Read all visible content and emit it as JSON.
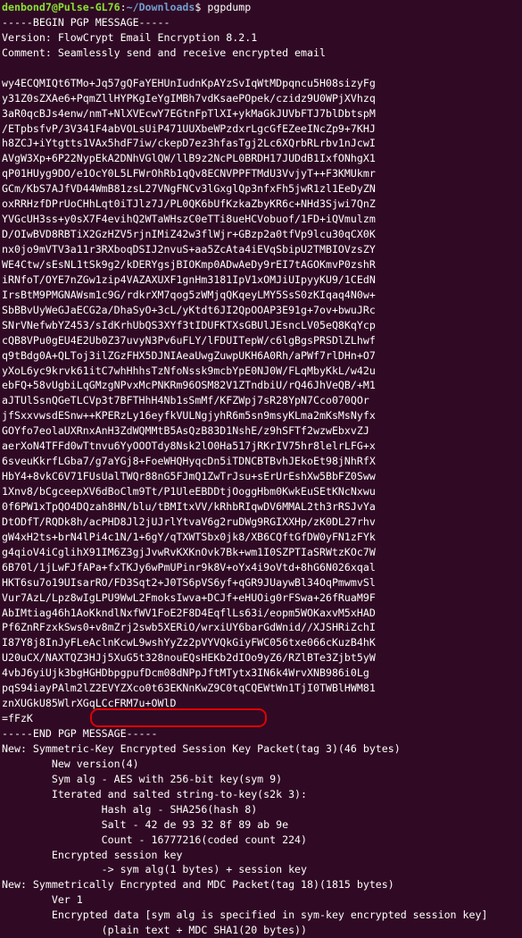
{
  "prompt": {
    "user_host": "denbond7@Pulse-GL76",
    "separator": ":",
    "path": "~/Downloads",
    "symbol": "$ ",
    "command": "pgpdump"
  },
  "lines": [
    "-----BEGIN PGP MESSAGE-----",
    "Version: FlowCrypt Email Encryption 8.2.1",
    "Comment: Seamlessly send and receive encrypted email",
    "",
    "wy4ECQMIQt6TMo+Jq57gQFaYEHUnIudnKpAYzSvIqWtMDpqncu5H08sizyFg",
    "y31Z0sZXAe6+PqmZllHYPKgIeYgIMBh7vdKsaePOpek/czidz9U0WPjXVhzq",
    "3aR0qcBJs4enw/nmT+NlXVEcwY7EGtnFpTlXI+ykMaGkJUVbFTJ7blDbtspM",
    "/ETpbsfvP/3V341F4abVOLsUiP471UUXbeWPzdxrLgcGfEZeeINcZp9+7KHJ",
    "h8ZCJ+iYtgtts1VAx5hdF7iw/ckepD7ez3hfasTgj2Lc6XQrbRLrbv1nJcwI",
    "AVgW3Xp+6P22NypEkA2DNhVGlQW/llB9z2NcPL0BRDH17JUDdB1IxfONhgX1",
    "qP01HUyg9DO/e1OcY0L5LFWrOhRb1qQv8ECNVPPFTMdU3VvjyT++F3KMUkmr",
    "GCm/KbS7AJfVD44WmB81zsL27VNgFNCv3lGxglQp3nfxFh5jwR1zl1EeDyZN",
    "oxRRHzfDPrUoCHhLqt0iTJlz7J/PL0QK6bUfKzkaZbyKR6c+NHd3Sjwi7QnZ",
    "YVGcUH3ss+y0sX7F4evihQ2WTaWHszC0eTTi8ueHCVobuof/1FD+iQVmulzm",
    "D/OIwBVD8RBTiX2GzHZV5rjnIMiZ42w3flWjr+GBzp2a0tfVp9lcu30qCX0K",
    "nx0jo9mVTV3a11r3RXboqDSIJ2nvuS+aa5ZcAta4iEVqSbipU2TMBIOVzsZY",
    "WE4Ctw/sEsNL1tSk9g2/kDERYgsjBIOKmp0ADwAeDy9rEI7tAGOKmvP0zshR",
    "iRNfoT/OYE7nZGw1zip4VAZAXUXF1gnHm3181IpV1xOMJiUIpyyKU9/1CEdN",
    "IrsBtM9PMGNAWsm1c9G/rdkrXM7qog5zWMjqQKqeyLMY5SsS0zKIqaq4N0w+",
    "SbBBvUyWeGJaECG2a/DhaSyO+3cL/yKtdt6JI2QpOOAP3E91g+7ov+bwuJRc",
    "SNrVNefwbYZ453/sIdKrhUbQS3XYf3tIDUFKTXsGBUlJEsncLV05eQ8KqYcp",
    "cQB8VPu0gEU4E2Ub0Z37uvyN3Pv6uFLY/lFDUITepW/c6lgBgsPRSDlZLhwf",
    "q9tBdg0A+QLToj3ilZGzFHX5DJNIAeaUwgZuwpUKH6A0Rh/aPWf7rlDHn+O7",
    "yXoL6yc9krvk61itC7whHhhsTzNfoNssk9mcbYpE0NJ0W/FLqMbyKkL/w42u",
    "ebFQ+58vUgbiLqGMzgNPvxMcPNKRm96OSM82V1ZTndbiU/rQ46JhVeQB/+M1",
    "aJTUlSsnQGeTLCVp3t7BFTHhH4Nb1sSmMf/KFZWpj7sR28YpN7Cco070QOr",
    "jfSxxvwsdESnw++KPERzLy16eyfkVULNgjyhR6m5sn9msyKLma2mKsMsNyfx",
    "GOYfo7eolaUXRnxAnH3ZdWQMMtB5AsQzB83D1NshE/z9hSFTf2wzwEbxvZJ",
    "aerXoN4TFFd0wTtnvu6YyOOOTdy8Nsk2lO0Ha517jRKrIV75hr8lelrLFG+x",
    "6sveuKkrfLGba7/g7aYGj8+FoeWHQHyqcDn5iTDNCBTBvhJEkoEt98jNhRfX",
    "HbY4+8vkC6V71FUsUalTWQr88nG5FJmQ1ZwTrJsu+sErUrEshXw5BbFZ0Sww",
    "1Xnv8/bCgceepXV6dBoClm9Tt/P1UleEBDDtjOoggHbm0KwkEuSEtKNcNxwu",
    "0f6PW1xTpQO4DQzah8HN/blu/tBMItxVV/kRhbRIqwDV6MMAL2th3rRSJvYa",
    "DtODfT/RQDk8h/acPHD8Jl2jUJrlYtvaV6g2ruDWg9RGIXXHp/zK0DL27rhv",
    "gW4xH2ts+brN4lPi4c1N/1+6gY/qTXWTSbx0jk8/XB6CQftGfDW0yFN1zFYk",
    "g4qioV4iCglihX91IM6Z3gjJvwRvKXKnOvk7Bk+wm1I0SZPTIaSRWtzKOc7W",
    "6B70l/1jLwFJfAPa+fxTKJy6wPmUPinr9k8V+oYx4i9oVtd+8hG6N026xqal",
    "HKT6su7o19UIsarRO/FD3Sqt2+J0TS6pVS6yf+qGR9JUaywBl34OqPmwmvSl",
    "Vur7AzL/Lpz8wIgLPU9WwL2FmoksIwva+DCJf+eHUOig0rFSwa+26fRuaM9F",
    "AbIMtiag46h1AoKkndlNxfWV1FoE2F8D4EqflLs63i/eopm5WOKaxvM5xHAD",
    "Pf6ZnRFzxkSws0+v8mZrj2swb5XERiO/wrxiUY6barGdWnid//XJSHRiZchI",
    "I87Y8j8InJyFLeAclnKcwL9wshYyZz2pVYVQkGiyFWC056txe066cKuzB4hK",
    "U20uCX/NAXTQZ3HJj5XuG5t328nouEQsHEKb2dIOo9yZ6/RZlBTe3Zjbt5yW",
    "4vbJ6yiUjk3bgHGHDbpgpufDcm08dNPpJftMTytx3IN6k4WrvXNB986i0Lg",
    "pqS94iayPAlm2lZ2EVYZXco0t63EKNnKwZ9C0tqCQEWtWn1TjI0TWBlHWM81",
    "znXUGkU85WlrXGqLCcFRM7u+OWlD",
    "=fFzK",
    "-----END PGP MESSAGE-----",
    "New: Symmetric-Key Encrypted Session Key Packet(tag 3)(46 bytes)",
    "        New version(4)",
    "        Sym alg - AES with 256-bit key(sym 9)",
    "        Iterated and salted string-to-key(s2k 3):",
    "                Hash alg - SHA256(hash 8)",
    "                Salt - 42 de 93 32 8f 89 ab 9e",
    "                Count - 16777216(coded count 224)",
    "        Encrypted session key",
    "                -> sym alg(1 bytes) + session key",
    "New: Symmetrically Encrypted and MDC Packet(tag 18)(1815 bytes)",
    "        Ver 1",
    "        Encrypted data [sym alg is specified in sym-key encrypted session key]",
    "                (plain text + MDC SHA1(20 bytes))"
  ]
}
